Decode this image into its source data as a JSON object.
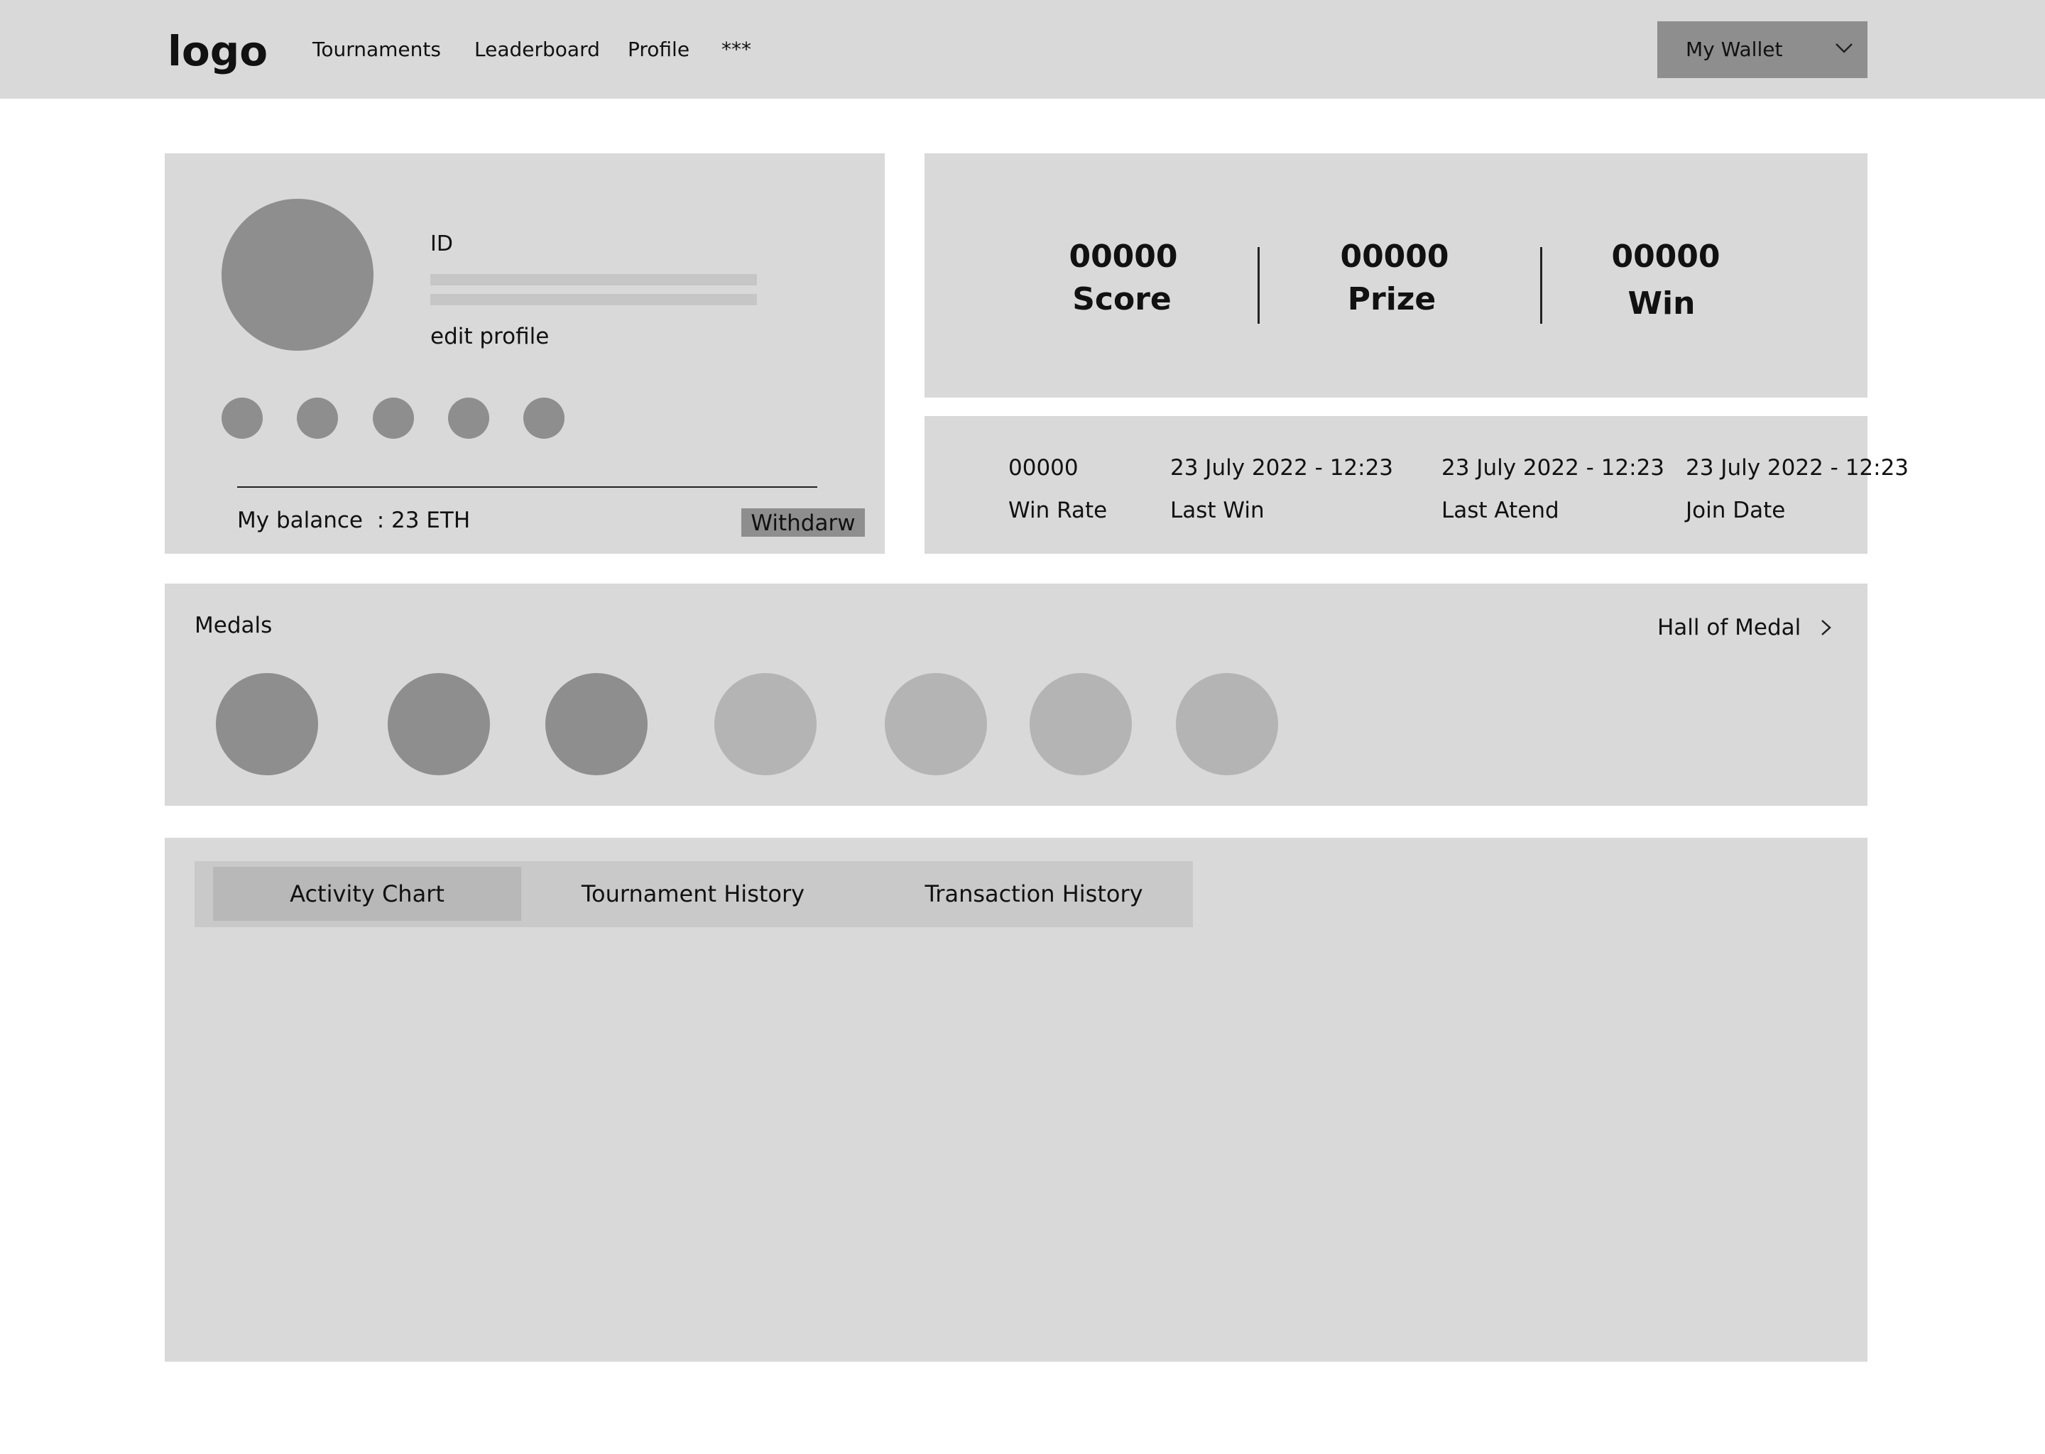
{
  "header": {
    "logo": "logo",
    "nav": [
      "Tournaments",
      "Leaderboard",
      "Profile",
      "***"
    ],
    "wallet_label": "My Wallet"
  },
  "profile": {
    "id_label": "ID",
    "edit_label": "edit profile",
    "social_count": 5,
    "balance_text": "My balance  : 23 ETH",
    "withdraw_label": "Withdarw"
  },
  "stats": [
    {
      "value": "00000",
      "label": "Score"
    },
    {
      "value": "00000",
      "label": "Prize"
    },
    {
      "value": "00000",
      "label": "Win"
    }
  ],
  "info": [
    {
      "value": "00000",
      "label": "Win Rate"
    },
    {
      "value": "23 July 2022 - 12:23",
      "label": "Last Win"
    },
    {
      "value": "23 July 2022 - 12:23",
      "label": "Last Atend"
    },
    {
      "value": "23 July 2022 - 12:23",
      "label": "Join Date"
    }
  ],
  "medals": {
    "title": "Medals",
    "link_label": "Hall of Medal",
    "earned_color": "#8e8e8e",
    "locked_color": "#b4b4b4",
    "items": [
      "earned",
      "earned",
      "earned",
      "locked",
      "locked",
      "locked",
      "locked"
    ]
  },
  "tabs": [
    {
      "label": "Activity Chart",
      "active": true
    },
    {
      "label": "Tournament History",
      "active": false
    },
    {
      "label": "Transaction History",
      "active": false
    }
  ]
}
